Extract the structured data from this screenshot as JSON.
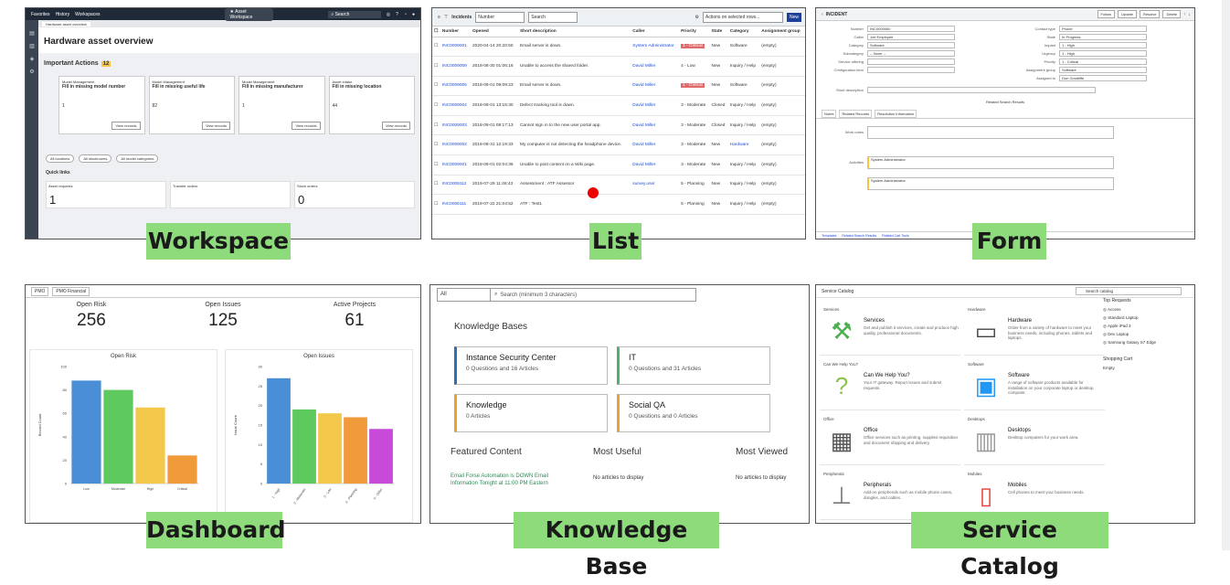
{
  "labels": {
    "workspace": "Workspace",
    "list": "List",
    "form": "Form",
    "dashboard": "Dashboard",
    "knowledge_base": "Knowledge Base",
    "service_catalog": "Service Catalog"
  },
  "workspace": {
    "nav": [
      "Favorites",
      "History",
      "Workspaces"
    ],
    "app_tab": "Asset Workspace",
    "search": "Search",
    "title": "Hardware asset overview",
    "important_actions": "Important Actions",
    "ia_count": "12",
    "cards": [
      {
        "category": "Model Management",
        "title": "Fill in missing model number",
        "value": "1",
        "button": "View records"
      },
      {
        "category": "Model Management",
        "title": "Fill in missing useful life",
        "value": "82",
        "button": "View records"
      },
      {
        "category": "Model Management",
        "title": "Fill in missing manufacturer",
        "value": "1",
        "button": "View records"
      },
      {
        "category": "Asset intake",
        "title": "Fill in missing location",
        "value": "44",
        "button": "View records"
      }
    ],
    "filters": [
      "All locations",
      "All stockrooms",
      "All model categories"
    ],
    "quick_links": "Quick links",
    "quick_cards": [
      {
        "label": "Asset requests",
        "value": "1"
      },
      {
        "label": "Transfer orders",
        "value": ""
      },
      {
        "label": "Stock orders",
        "value": "0"
      }
    ]
  },
  "list": {
    "title": "Incidents",
    "field": "Number",
    "search": "Search",
    "actions": "Actions on selected rows...",
    "new": "New",
    "columns": [
      "Number",
      "Opened",
      "Short description",
      "Caller",
      "Priority",
      "State",
      "Category",
      "Assignment group"
    ],
    "rows": [
      {
        "num": "INC0009001",
        "opened": "2020-04-14 20:20:50",
        "desc": "Email server is down.",
        "caller": "System Administrator",
        "pri": "1 - Critical",
        "crit": true,
        "state": "New",
        "cat": "Software",
        "group": "(empty)"
      },
      {
        "num": "INC0009009",
        "opened": "2018-08-30 01:06:16",
        "desc": "Unable to access the shared folder.",
        "caller": "David Miller",
        "pri": "4 - Low",
        "crit": false,
        "state": "New",
        "cat": "Inquiry / Help",
        "group": "(empty)"
      },
      {
        "num": "INC0009005",
        "opened": "2018-09-01 09:09:23",
        "desc": "Email server is down.",
        "caller": "David Miller",
        "pri": "1 - Critical",
        "crit": true,
        "state": "New",
        "cat": "Software",
        "group": "(empty)"
      },
      {
        "num": "INC0009004",
        "opened": "2018-09-01 13:15:30",
        "desc": "Defect tracking tool is down.",
        "caller": "David Miller",
        "pri": "3 - Moderate",
        "crit": false,
        "state": "Closed",
        "cat": "Inquiry / Help",
        "group": "(empty)"
      },
      {
        "num": "INC0009003",
        "opened": "2018-09-01 09:17:13",
        "desc": "Cannot sign in to the new user portal app.",
        "caller": "David Miller",
        "pri": "3 - Moderate",
        "crit": false,
        "state": "Closed",
        "cat": "Inquiry / Help",
        "group": "(empty)"
      },
      {
        "num": "INC0009002",
        "opened": "2018-08-31 12:19:33",
        "desc": "My computer is not detecting the headphone device.",
        "caller": "David Miller",
        "pri": "3 - Moderate",
        "crit": false,
        "state": "New",
        "cat": "Hardware",
        "group": "(empty)"
      },
      {
        "num": "INC0009001",
        "opened": "2018-09-01 02:04:36",
        "desc": "Unable to post content on a Wiki page.",
        "caller": "David Miller",
        "pri": "3 - Moderate",
        "crit": false,
        "state": "New",
        "cat": "Inquiry / Help",
        "group": "(empty)"
      },
      {
        "num": "INC0008112",
        "opened": "2019-07-29 11:48:43",
        "desc": "Assessment : ATF Assessor",
        "caller": "survey.user",
        "pri": "5 - Planning",
        "crit": false,
        "state": "New",
        "cat": "Inquiry / Help",
        "group": "(empty)"
      },
      {
        "num": "INC0008111",
        "opened": "2019-07-22 21:04:52",
        "desc": "ATF : Test1",
        "caller": "",
        "pri": "5 - Planning",
        "crit": false,
        "state": "New",
        "cat": "Inquiry / Help",
        "group": "(empty)"
      }
    ]
  },
  "form": {
    "title": "INCIDENT",
    "buttons": [
      "Follow",
      "Update",
      "Resolve",
      "Delete"
    ],
    "left_fields": [
      {
        "label": "Number",
        "value": "INC0000060"
      },
      {
        "label": "Caller",
        "value": "Joe Employee"
      },
      {
        "label": "Category",
        "value": "Software"
      },
      {
        "label": "Subcategory",
        "value": "-- None --"
      },
      {
        "label": "Service offering",
        "value": ""
      },
      {
        "label": "Configuration item",
        "value": ""
      }
    ],
    "right_fields": [
      {
        "label": "Contact type",
        "value": "Phone"
      },
      {
        "label": "State",
        "value": "In Progress"
      },
      {
        "label": "Impact",
        "value": "1 - High"
      },
      {
        "label": "Urgency",
        "value": "1 - High"
      },
      {
        "label": "Priority",
        "value": "1 - Critical"
      },
      {
        "label": "Assignment group",
        "value": "Software"
      },
      {
        "label": "Assigned to",
        "value": "Don Goodliffe"
      }
    ],
    "short_description_label": "Short description",
    "related_search": "Related Search Results",
    "tabs": [
      "Notes",
      "Related Records",
      "Resolution Information"
    ],
    "work_notes_label": "Work notes",
    "activities": "Activities",
    "author": "System Administrator",
    "footer": [
      "Templates",
      "Related Search Results",
      "Related Cart Tools"
    ]
  },
  "dashboard": {
    "tabs": [
      "PMO",
      "PMO Financial"
    ],
    "stats": [
      {
        "label": "Open Risk",
        "value": "256"
      },
      {
        "label": "Open Issues",
        "value": "125"
      },
      {
        "label": "Active Projects",
        "value": "61"
      }
    ],
    "chart_data": [
      {
        "type": "bar",
        "title": "Open Risk",
        "categories": [
          "Low",
          "Moderate",
          "High",
          "Critical"
        ],
        "values": [
          88,
          80,
          65,
          24
        ],
        "colors": [
          "#4a8fd6",
          "#5ec95e",
          "#f4c84a",
          "#f09a3a"
        ],
        "ylim": [
          0,
          100
        ],
        "ylabel": "Record Count",
        "yticks": [
          "100",
          "80",
          "60",
          "40",
          "20",
          "0"
        ]
      },
      {
        "type": "bar",
        "title": "Open Issues",
        "categories": [
          "1 - High",
          "2 - Moderate",
          "3 - Low",
          "4 - Planning",
          "5 - Other"
        ],
        "values": [
          27,
          19,
          18,
          17,
          14
        ],
        "colors": [
          "#4a8fd6",
          "#5ec95e",
          "#f4c84a",
          "#f09a3a",
          "#c84ad8"
        ],
        "ylim": [
          0,
          30
        ],
        "ylabel": "Issue Count",
        "yticks": [
          "30",
          "25",
          "20",
          "15",
          "10",
          "5",
          "0"
        ]
      }
    ]
  },
  "kb": {
    "select": "All",
    "search": "Search (minimum 3 characters)",
    "heading": "Knowledge Bases",
    "cards": [
      {
        "title": "Instance Security Center",
        "sub": "0 Questions and 16 Articles",
        "color": "#2f6fae"
      },
      {
        "title": "IT",
        "sub": "0 Questions and 31 Articles",
        "color": "#4caf6e"
      },
      {
        "title": "Knowledge",
        "sub": "0 Articles",
        "color": "#e8a233"
      },
      {
        "title": "Social QA",
        "sub": "0 Questions and 0 Articles",
        "color": "#e8a233"
      }
    ],
    "featured": "Featured Content",
    "featured_text": "Email Forse Automation is DOWN Email Information Tonight at 11:00 PM Eastern",
    "most_useful": "Most Useful",
    "most_useful_text": "No articles to display",
    "most_viewed": "Most Viewed",
    "most_viewed_text": "No articles to display"
  },
  "catalog": {
    "title": "Service Catalog",
    "search": "Search catalog",
    "items": [
      {
        "cat": "Services",
        "name": "Services",
        "desc": "Get and publish it services, create and produce high quality, professional documents."
      },
      {
        "cat": "Hardware",
        "name": "Hardware",
        "desc": "Order from a variety of hardware to meet your business needs, including phones, tablets and laptops."
      },
      {
        "cat": "Can We Help You?",
        "name": "Can We Help You?",
        "desc": "Your IT gateway. Report issues and submit requests."
      },
      {
        "cat": "Software",
        "name": "Software",
        "desc": "A range of software products available for installation on your corporate laptop or desktop computer."
      },
      {
        "cat": "Office",
        "name": "Office",
        "desc": "Office services such as printing, supplies requisition and document shipping and delivery."
      },
      {
        "cat": "Desktops",
        "name": "Desktops",
        "desc": "Desktop computers for your work area."
      },
      {
        "cat": "Peripherals",
        "name": "Peripherals",
        "desc": "Add-on peripherals such as mobile phone cases, dongles, and cables."
      },
      {
        "cat": "Mobiles",
        "name": "Mobiles",
        "desc": "Cell phones to meet your business needs."
      }
    ],
    "top_requests": "Top Requests",
    "requests": [
      "Access",
      "Standard Laptop",
      "Apple iPad 3",
      "Dev Laptop",
      "Samsung Galaxy S7 Edge"
    ],
    "cart": "Shopping Cart",
    "cart_state": "Empty"
  }
}
